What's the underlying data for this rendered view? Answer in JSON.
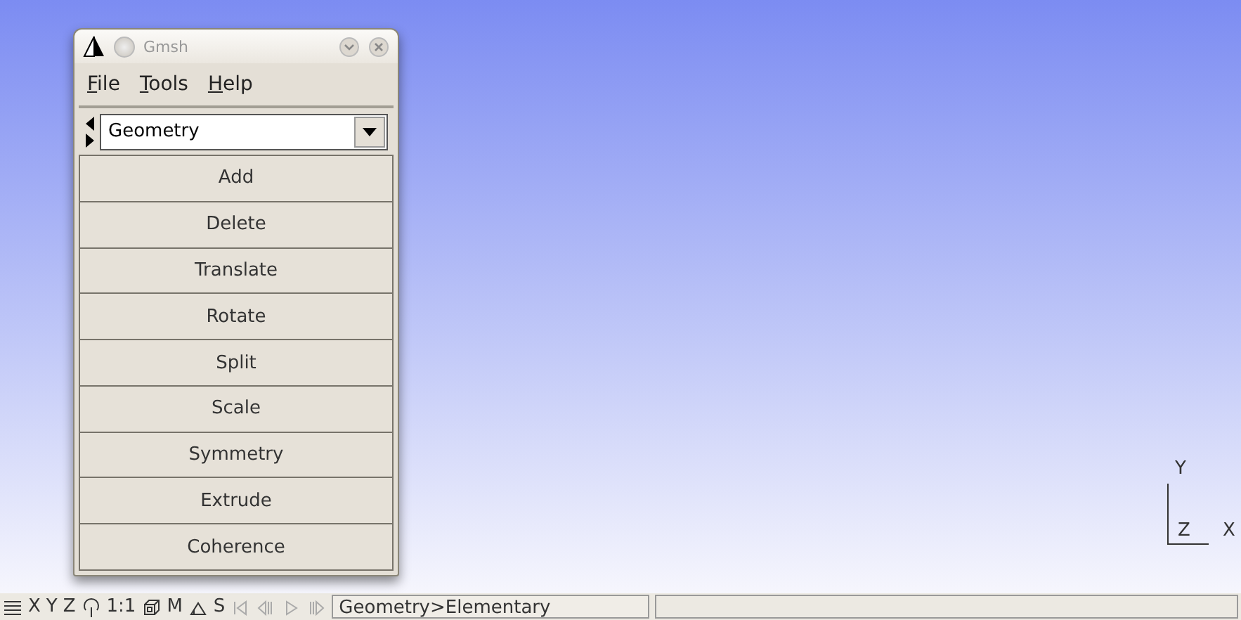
{
  "window": {
    "title": "Gmsh"
  },
  "menu": [
    {
      "label": "File"
    },
    {
      "label": "Tools"
    },
    {
      "label": "Help"
    }
  ],
  "module_select": {
    "value": "Geometry"
  },
  "buttons": [
    "Add",
    "Delete",
    "Translate",
    "Rotate",
    "Split",
    "Scale",
    "Symmetry",
    "Extrude",
    "Coherence"
  ],
  "axes": {
    "y": "Y",
    "z": "Z",
    "x": "X"
  },
  "status_bar": {
    "tools": [
      {
        "kind": "icon"
      },
      {
        "kind": "text",
        "label": "X"
      },
      {
        "kind": "text",
        "label": "Y"
      },
      {
        "kind": "text",
        "label": "Z"
      },
      {
        "kind": "icon"
      },
      {
        "kind": "text",
        "label": "1:1"
      },
      {
        "kind": "icon"
      },
      {
        "kind": "text",
        "label": "M"
      },
      {
        "kind": "icon"
      },
      {
        "kind": "text",
        "label": "S"
      },
      {
        "kind": "icon"
      },
      {
        "kind": "icon"
      },
      {
        "kind": "icon"
      },
      {
        "kind": "icon"
      }
    ],
    "message": "Geometry>Elementary"
  }
}
